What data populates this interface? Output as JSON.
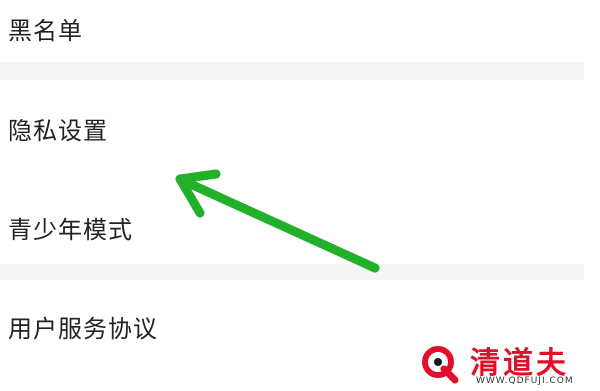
{
  "settings_list": {
    "items": [
      {
        "label": "黑名单"
      },
      {
        "label": "隐私设置"
      },
      {
        "label": "青少年模式"
      },
      {
        "label": "用户服务协议"
      }
    ]
  },
  "annotation": {
    "arrow_color": "#22b02a",
    "points_to": "隐私设置"
  },
  "watermark": {
    "brand": "清道夫",
    "url": "WWW.QDFUJI.COM",
    "brand_color": "#e0102a"
  }
}
